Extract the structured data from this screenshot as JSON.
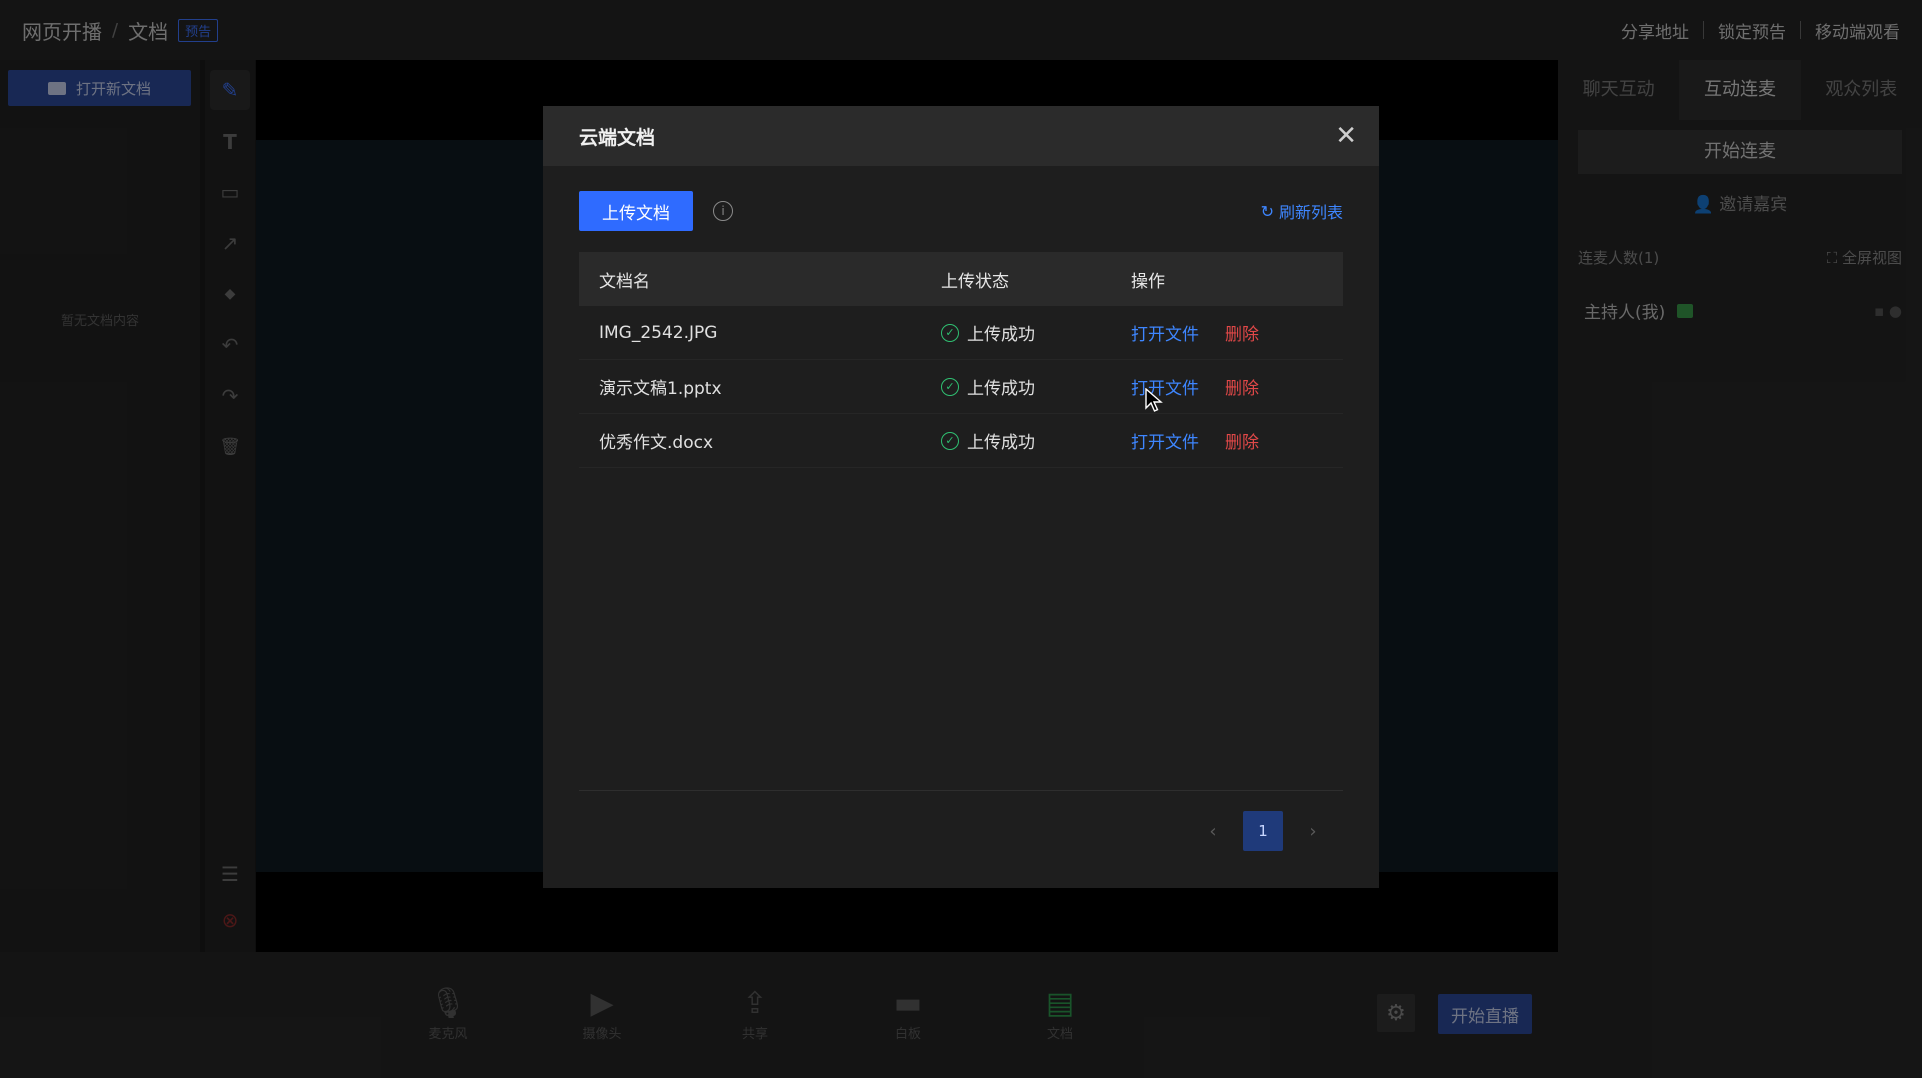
{
  "header": {
    "crumb_root": "网页开播",
    "crumb_sep": "/",
    "crumb_current": "文档",
    "badge": "预告",
    "links": [
      "分享地址",
      "锁定预告",
      "移动端观看"
    ]
  },
  "left_panel": {
    "open_doc_label": "打开新文档",
    "empty_hint": "暂无文档内容"
  },
  "tools": [
    {
      "name": "pen-tool",
      "glyph": "✎"
    },
    {
      "name": "text-tool",
      "glyph": "T"
    },
    {
      "name": "rect-tool",
      "glyph": "▭"
    },
    {
      "name": "arrow-tool",
      "glyph": "↗"
    },
    {
      "name": "eraser-tool",
      "glyph": "◆"
    },
    {
      "name": "undo-tool",
      "glyph": "↶"
    },
    {
      "name": "redo-tool",
      "glyph": "↷"
    },
    {
      "name": "delete-tool",
      "glyph": "🗑"
    }
  ],
  "right_panel": {
    "tabs": [
      "聊天互动",
      "互动连麦",
      "观众列表"
    ],
    "start_lianmai": "开始连麦",
    "invite": "邀请嘉宾",
    "count_label": "连麦人数(1)",
    "fullscreen": "全屏视图",
    "host_label": "主持人(我)"
  },
  "bottom_bar": {
    "items": [
      "麦克风",
      "摄像头",
      "共享",
      "白板",
      "文档"
    ],
    "go_live": "开始直播"
  },
  "modal": {
    "title": "云端文档",
    "upload_label": "上传文档",
    "refresh_label": "刷新列表",
    "columns": [
      "文档名",
      "上传状态",
      "操作"
    ],
    "rows": [
      {
        "name": "IMG_2542.JPG",
        "status": "上传成功",
        "open": "打开文件",
        "delete": "删除"
      },
      {
        "name": "演示文稿1.pptx",
        "status": "上传成功",
        "open": "打开文件",
        "delete": "删除"
      },
      {
        "name": "优秀作文.docx",
        "status": "上传成功",
        "open": "打开文件",
        "delete": "删除"
      }
    ],
    "page": "1"
  }
}
